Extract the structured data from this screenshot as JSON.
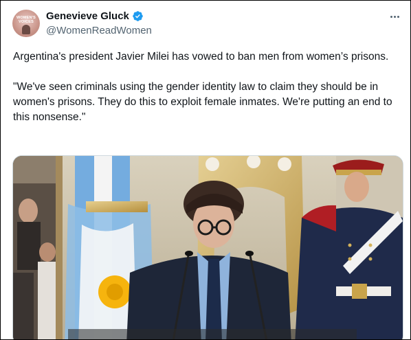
{
  "tweet": {
    "author": {
      "display_name": "Genevieve Gluck",
      "handle": "@WomenReadWomen",
      "avatar_text": "WOMEN'S VOICES",
      "verified_icon": "verified-badge-icon",
      "verified_color": "#1d9bf0"
    },
    "more_icon": "more-horizontal-icon",
    "text": {
      "paragraph1": "Argentina's president Javier Milei has vowed to ban men from women’s prisons.",
      "paragraph2": "\"We've seen criminals using the gender identity law to claim they should be in women's prisons. They do this to exploit female inmates. We're putting an end to this nonsense.\""
    },
    "media": {
      "type": "photo"
    }
  }
}
